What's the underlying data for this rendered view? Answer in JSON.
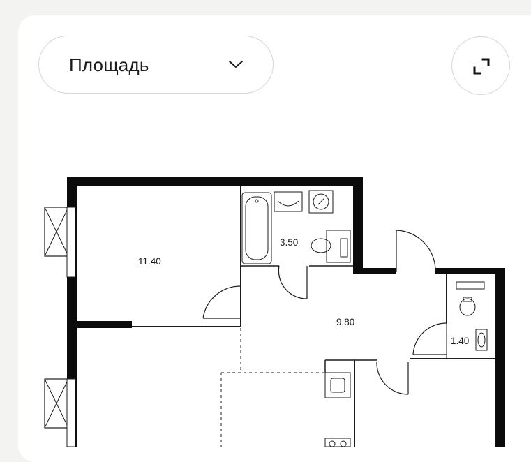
{
  "filter": {
    "selected_label": "Площадь",
    "chevron_icon": "chevron-down-icon"
  },
  "expand_button": {
    "icon": "expand-icon"
  },
  "floor_plan": {
    "rooms": [
      {
        "id": "bedroom",
        "area": "11.40"
      },
      {
        "id": "bathroom",
        "area": "3.50"
      },
      {
        "id": "hallway",
        "area": "9.80"
      },
      {
        "id": "toilet",
        "area": "1.40"
      }
    ]
  },
  "colors": {
    "wall": "#0b0b0b",
    "line": "#1c1c1c",
    "background": "#f3f3f1",
    "card": "#ffffff"
  }
}
